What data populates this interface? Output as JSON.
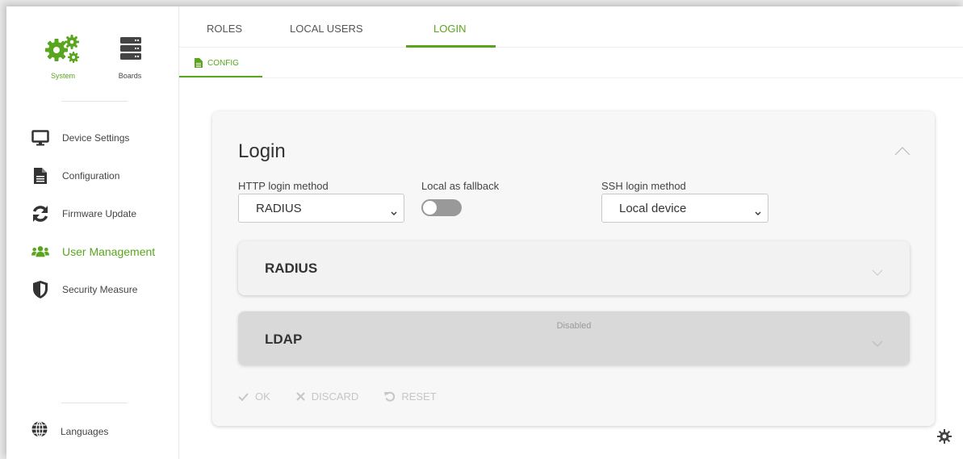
{
  "modules": [
    {
      "label": "System",
      "icon": "gears-icon",
      "active": true
    },
    {
      "label": "Boards",
      "icon": "server-icon",
      "active": false
    }
  ],
  "nav": [
    {
      "label": "Device Settings",
      "icon": "monitor-icon"
    },
    {
      "label": "Configuration",
      "icon": "file-icon"
    },
    {
      "label": "Firmware Update",
      "icon": "refresh-icon"
    },
    {
      "label": "User Management",
      "icon": "users-icon",
      "active": true
    },
    {
      "label": "Security Measure",
      "icon": "shield-icon"
    }
  ],
  "languages_label": "Languages",
  "tabs": [
    {
      "label": "ROLES"
    },
    {
      "label": "LOCAL USERS"
    },
    {
      "label": "LOGIN",
      "active": true
    }
  ],
  "subtab": {
    "label": "CONFIG"
  },
  "card": {
    "title": "Login",
    "http_login_method": {
      "label": "HTTP login method",
      "value": "RADIUS"
    },
    "local_fallback": {
      "label": "Local as fallback",
      "enabled": false
    },
    "ssh_login_method": {
      "label": "SSH login method",
      "value": "Local device"
    },
    "panels": [
      {
        "title": "RADIUS"
      },
      {
        "title": "LDAP",
        "status": "Disabled"
      }
    ],
    "actions": {
      "ok": "OK",
      "discard": "DISCARD",
      "reset": "RESET"
    }
  },
  "colors": {
    "accent": "#5aa51e",
    "text": "#333333",
    "muted": "#c6c6c6"
  }
}
